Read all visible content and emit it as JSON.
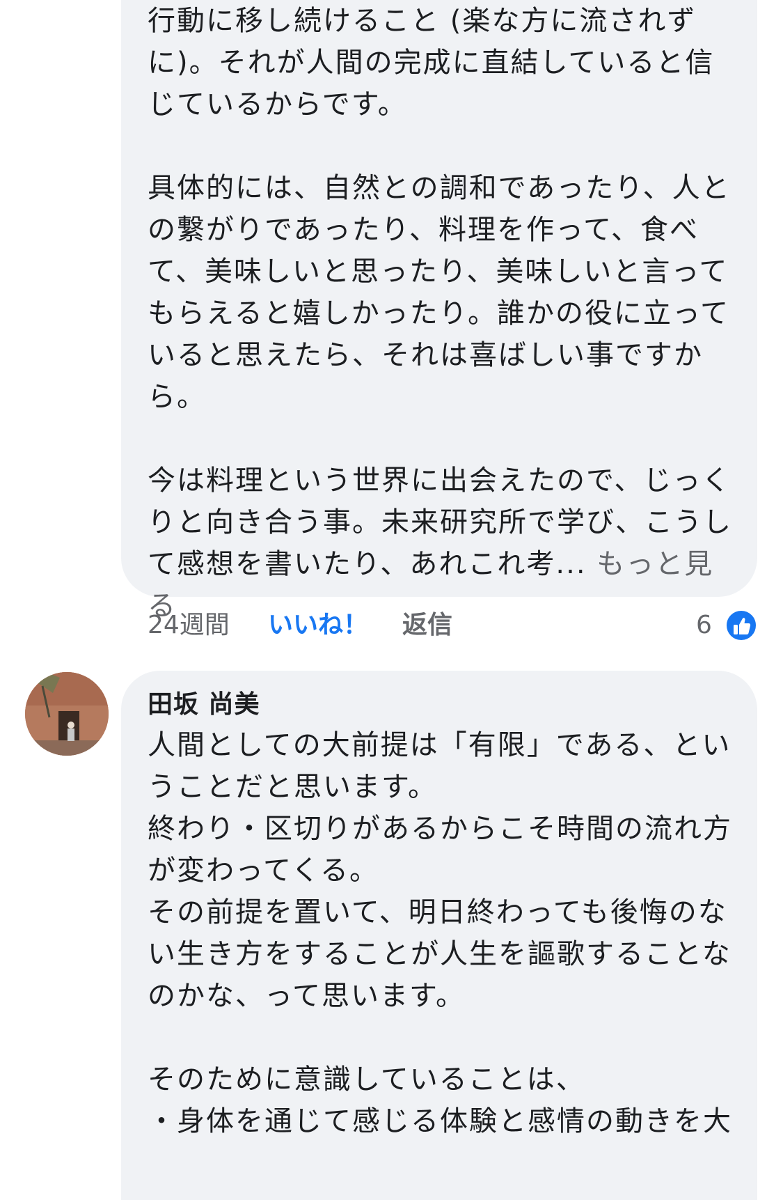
{
  "comment1": {
    "paragraphs": [
      "行動に移し続けること (楽な方に流されずに)。それが人間の完成に直結していると信じているからです。",
      "具体的には、自然との調和であったり、人との繋がりであったり、料理を作って、食べて、美味しいと思ったり、美味しいと言ってもらえると嬉しかったり。誰かの役に立っていると思えたら、それは喜ばしい事ですから。",
      "今は料理という世界に出会えたので、じっくりと向き合う事。未来研究所で学び、こうして感想を書いたり、あれこれ考..."
    ],
    "see_more": "もっと見る",
    "time": "24週間",
    "like_label": "いいね！",
    "reply_label": "返信",
    "reaction_count": "6",
    "reaction_icon": "thumbs-up-icon",
    "reaction_color": "#1877f2"
  },
  "comment2": {
    "author": "田坂 尚美",
    "paragraphs": [
      "人間としての大前提は「有限」である、ということだと思います。\n終わり・区切りがあるからこそ時間の流れ方が変わってくる。\nその前提を置いて、明日終わっても後悔のない生き方をすることが人生を謳歌することなのかな、って思います。",
      "そのために意識していることは、\n・身体を通じて感じる体験と感情の動きを大"
    ]
  },
  "colors": {
    "bubble_bg": "#f0f2f5",
    "text": "#1c1e21",
    "muted": "#65676b",
    "link": "#1877f2"
  }
}
